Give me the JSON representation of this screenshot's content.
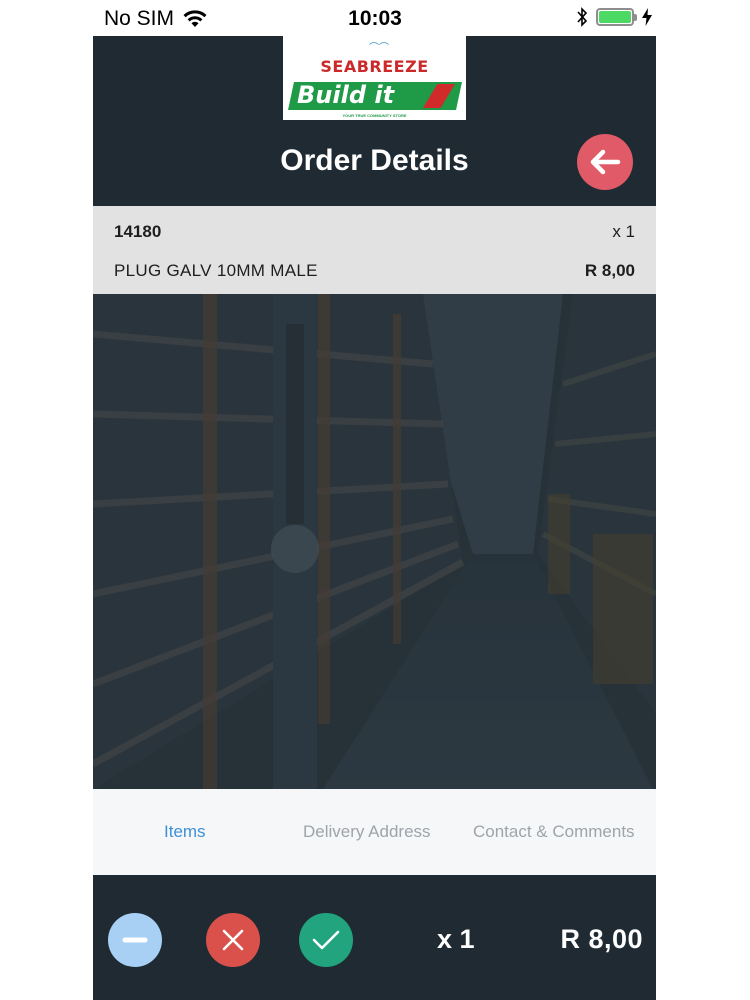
{
  "status_bar": {
    "carrier": "No SIM",
    "time": "10:03",
    "battery_level": 1.0
  },
  "header": {
    "logo": {
      "brand_top": "Seabreeze",
      "brand_main": "Build it",
      "tagline": "YOUR TRUE COMMUNITY STORE"
    },
    "title": "Order Details",
    "back_icon": "arrow-left-icon"
  },
  "order_item": {
    "code": "14180",
    "quantity": "x 1",
    "name": "PLUG GALV 10MM MALE",
    "price": "R 8,00"
  },
  "tabs": [
    {
      "label": "Items",
      "active": true
    },
    {
      "label": "Delivery Address",
      "active": false
    },
    {
      "label": "Contact & Comments",
      "active": false
    }
  ],
  "toolbar": {
    "buttons": [
      {
        "icon": "minus-icon",
        "color": "#a8d0f5"
      },
      {
        "icon": "close-icon",
        "color": "#d9514a"
      },
      {
        "icon": "check-icon",
        "color": "#22a47f"
      }
    ],
    "total_quantity": "x 1",
    "total_price": "R 8,00"
  },
  "colors": {
    "header_bg": "#1f2a32",
    "back_button": "#e05a67",
    "active_tab": "#3f8fd6",
    "inactive_tab": "#9ea4a9"
  }
}
